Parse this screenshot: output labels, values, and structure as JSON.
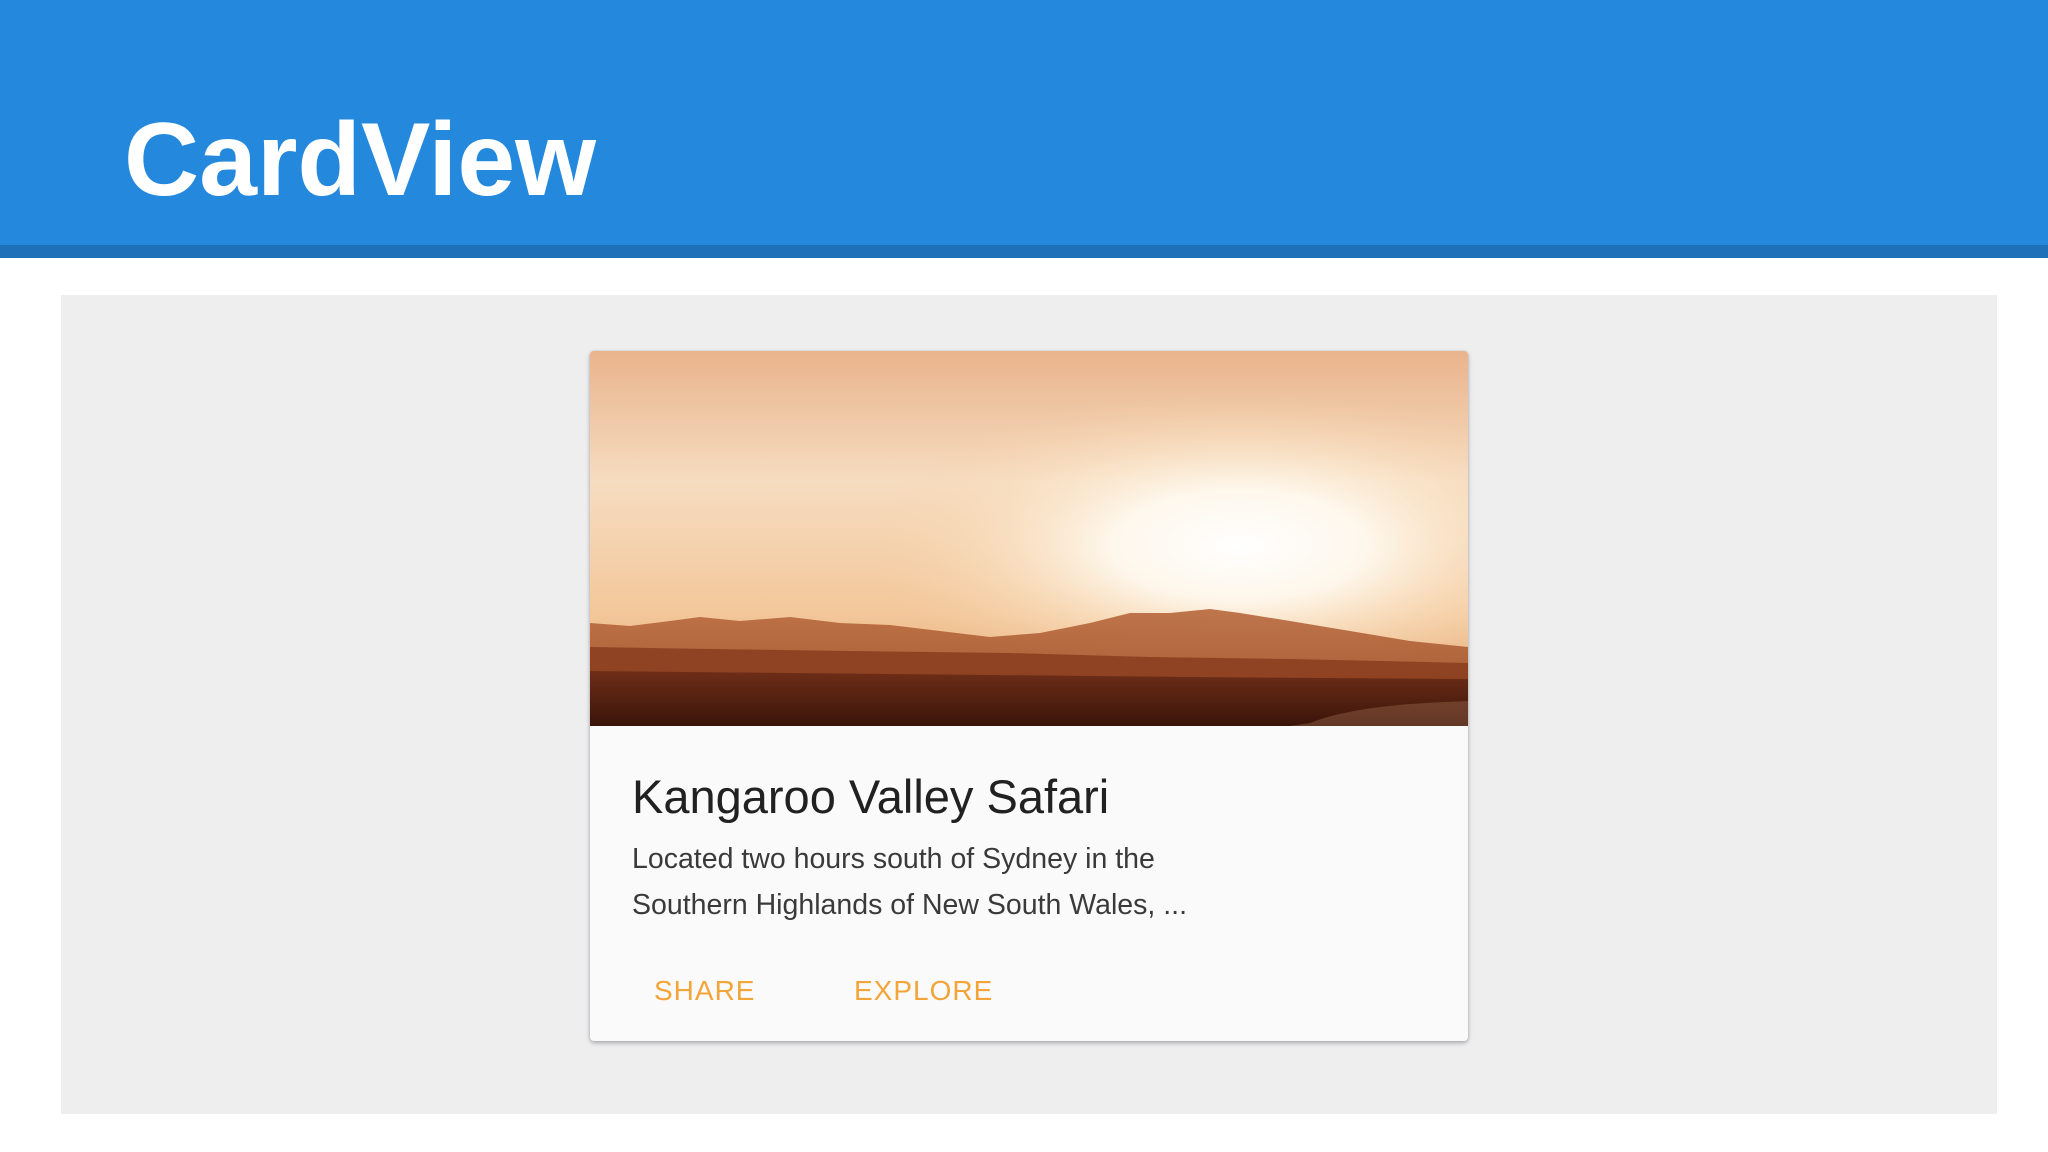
{
  "slide": {
    "title": "CardView"
  },
  "colors": {
    "header_background": "#2489dd",
    "header_rule": "#1e71b9",
    "screen_background": "#eeeeef",
    "card_background": "#fafafa",
    "action_text": "#f4a53a"
  },
  "card": {
    "image": {
      "subject": "sunset-over-mountain-valley"
    },
    "title": "Kangaroo Valley Safari",
    "description_lines": [
      "Located two hours south of Sydney in the",
      "Southern Highlands of New South Wales, ..."
    ],
    "actions": [
      {
        "label": "SHARE"
      },
      {
        "label": "EXPLORE"
      }
    ]
  }
}
